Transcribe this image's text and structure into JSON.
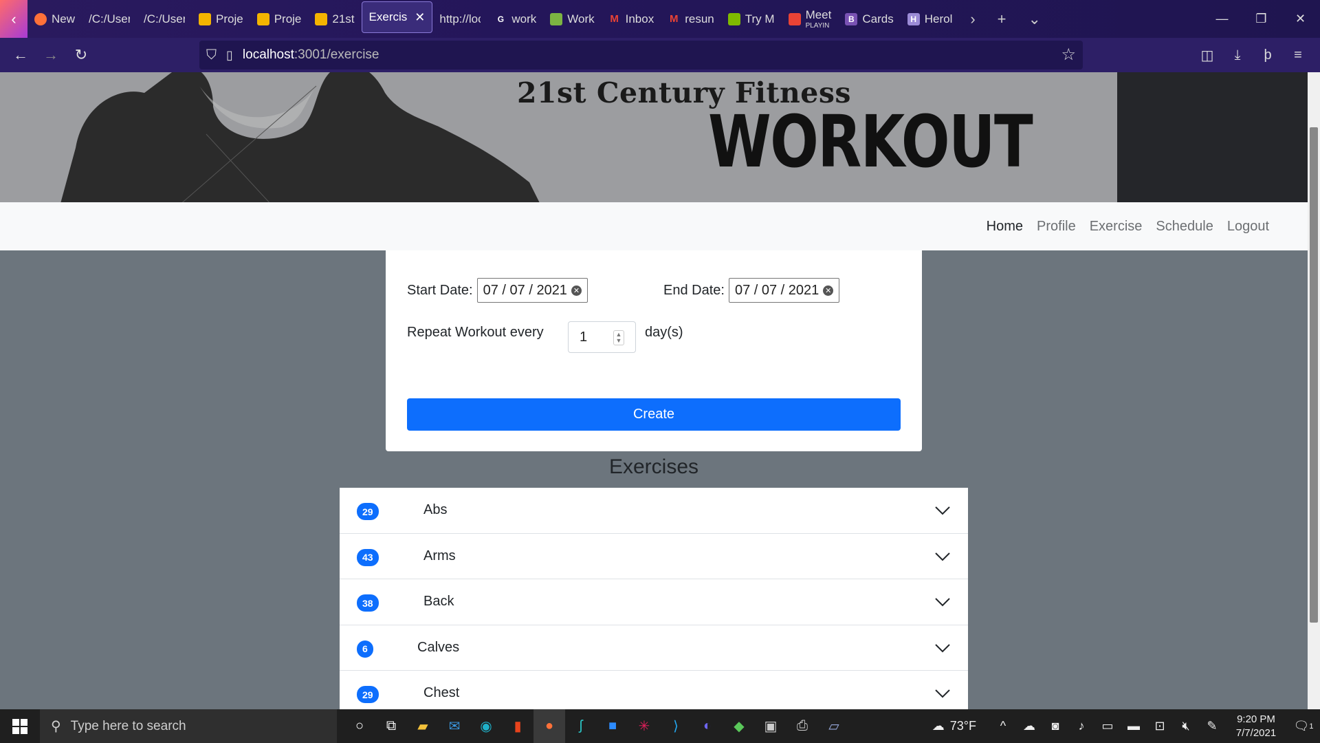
{
  "browser": {
    "tabs": [
      {
        "label": "New",
        "fav": "firefox",
        "color": "#ff7139"
      },
      {
        "label": "/C:/Users",
        "fav": "",
        "color": ""
      },
      {
        "label": "/C:/Users",
        "fav": "",
        "color": ""
      },
      {
        "label": "Proje",
        "fav": "slides",
        "color": "#f4b400"
      },
      {
        "label": "Proje",
        "fav": "slides",
        "color": "#f4b400"
      },
      {
        "label": "21st",
        "fav": "slides",
        "color": "#f4b400"
      },
      {
        "label": "Exercis",
        "fav": "",
        "color": "",
        "active": true
      },
      {
        "label": "http://loc",
        "fav": "",
        "color": ""
      },
      {
        "label": "work",
        "fav": "google",
        "color": "#ffffff"
      },
      {
        "label": "Work",
        "fav": "doc",
        "color": "#7cb342"
      },
      {
        "label": "Inbox",
        "fav": "gmail",
        "color": "#ea4335"
      },
      {
        "label": "resun",
        "fav": "gmail",
        "color": "#ea4335"
      },
      {
        "label": "Try M",
        "fav": "microsoft",
        "color": "#7fba00"
      },
      {
        "label": "Meet",
        "sub": "PLAYIN",
        "fav": "meet",
        "color": "#ea4335"
      },
      {
        "label": "Cards",
        "fav": "B",
        "color": "#7952b3"
      },
      {
        "label": "Herol",
        "fav": "H",
        "color": "#9b8bd6"
      }
    ],
    "url_host": "localhost",
    "url_rest": ":3001/exercise"
  },
  "hero": {
    "brand": "21st Century Fitness",
    "headline": "WORKOUT"
  },
  "nav": {
    "items": [
      "Home",
      "Profile",
      "Exercise",
      "Schedule",
      "Logout"
    ]
  },
  "form": {
    "start_label": "Start Date:",
    "start_value": "07 / 07 / 2021",
    "end_label": "End Date:",
    "end_value": "07 / 07 / 2021",
    "repeat_label": "Repeat Workout every",
    "repeat_value": "1",
    "repeat_unit": "day(s)",
    "create_label": "Create"
  },
  "exercises": {
    "title": "Exercises",
    "items": [
      {
        "count": "29",
        "name": "Abs"
      },
      {
        "count": "43",
        "name": "Arms"
      },
      {
        "count": "38",
        "name": "Back"
      },
      {
        "count": "6",
        "name": "Calves"
      },
      {
        "count": "29",
        "name": "Chest"
      }
    ]
  },
  "taskbar": {
    "search_placeholder": "Type here to search",
    "weather": "73°F",
    "time": "9:20 PM",
    "date": "7/7/2021",
    "notifications": "1"
  },
  "colors": {
    "primary": "#0d6efd",
    "page_bg": "#6c757d",
    "browser_bg": "#2d1f66"
  }
}
